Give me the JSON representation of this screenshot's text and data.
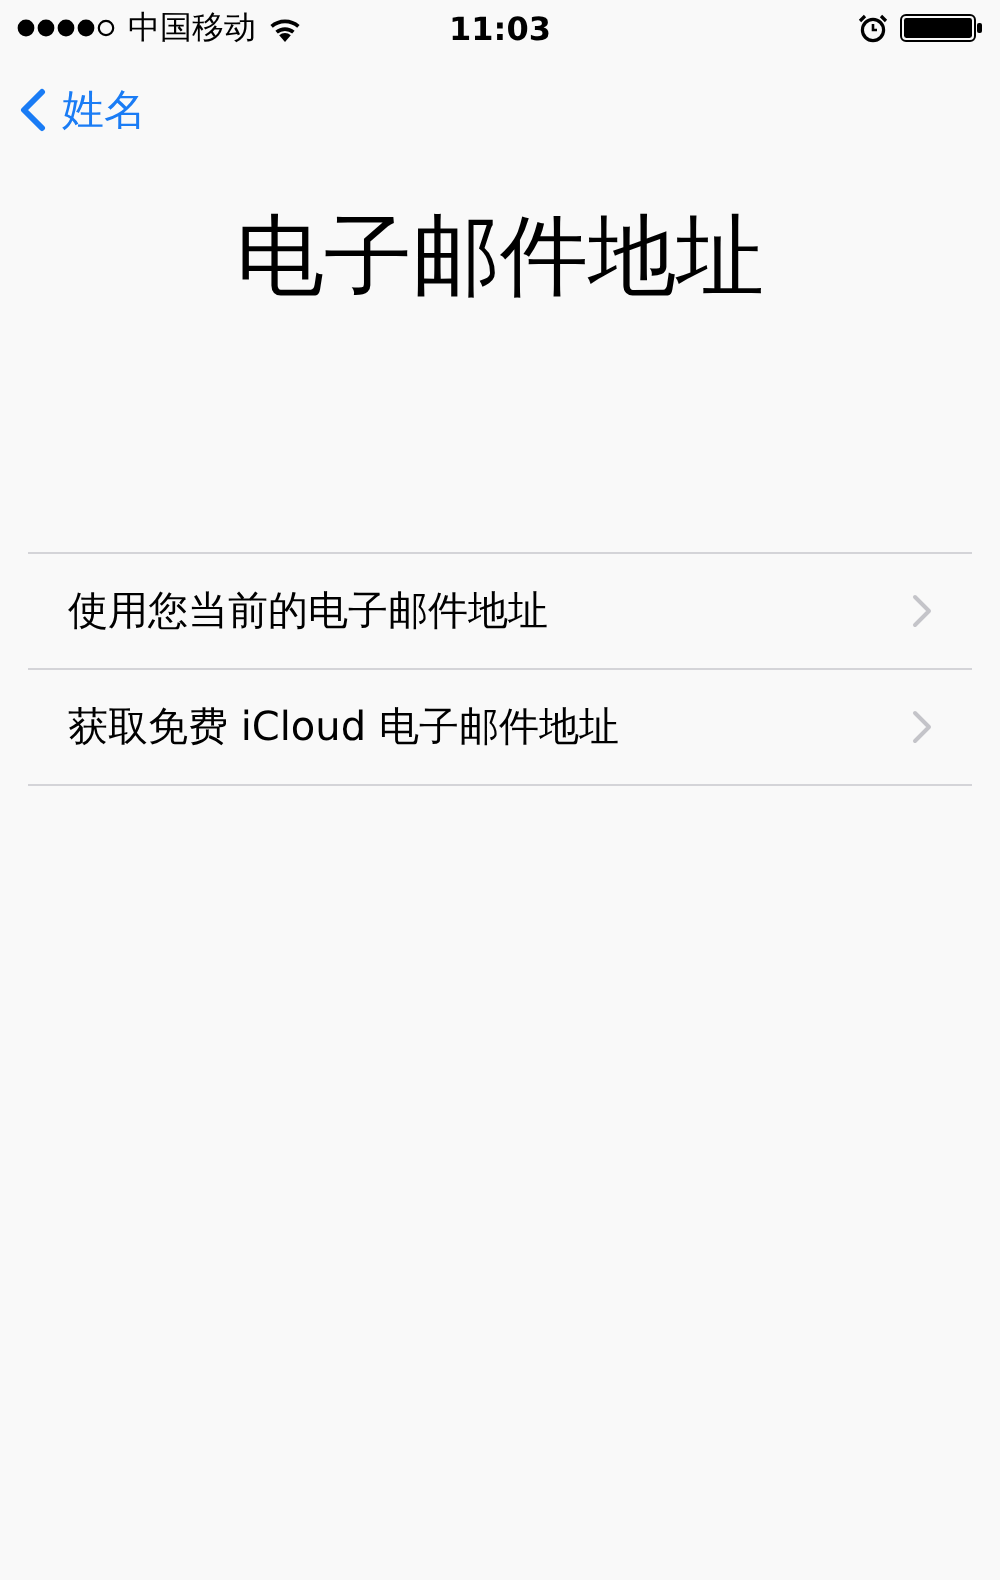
{
  "status_bar": {
    "carrier": "中国移动",
    "time": "11:03"
  },
  "nav": {
    "back_label": "姓名"
  },
  "title": "电子邮件地址",
  "options": [
    {
      "label": "使用您当前的电子邮件地址"
    },
    {
      "label": "获取免费 iCloud 电子邮件地址"
    }
  ]
}
